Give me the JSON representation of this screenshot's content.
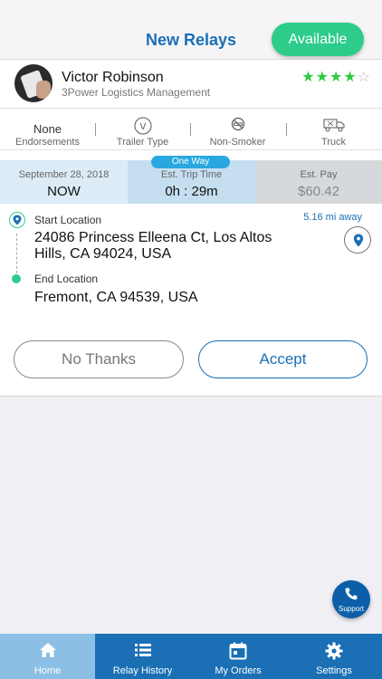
{
  "header": {
    "title": "New Relays",
    "status_button": "Available"
  },
  "driver": {
    "name": "Victor Robinson",
    "company": "3Power Logistics Management",
    "rating": 4,
    "rating_max": 5
  },
  "attributes": [
    {
      "value": "None",
      "label": "Endorsements",
      "icon": ""
    },
    {
      "value": "",
      "label": "Trailer Type",
      "icon": "v-circle-icon"
    },
    {
      "value": "",
      "label": "Non-Smoker",
      "icon": "no-smoking-icon"
    },
    {
      "value": "",
      "label": "Truck",
      "icon": "truck-icon"
    }
  ],
  "trip": {
    "tag": "One Way",
    "date_label": "September 28, 2018",
    "date_value": "NOW",
    "time_label": "Est. Trip Time",
    "time_value": "0h : 29m",
    "pay_label": "Est. Pay",
    "pay_value": "$60.42"
  },
  "route": {
    "distance": "5.16 mi away",
    "start_label": "Start Location",
    "start_address": "24086 Princess Elleena Ct, Los Altos Hills, CA 94024, USA",
    "end_label": "End Location",
    "end_address": "Fremont, CA 94539, USA"
  },
  "actions": {
    "decline": "No Thanks",
    "accept": "Accept"
  },
  "support": {
    "label": "Support"
  },
  "tabs": [
    {
      "label": "Home",
      "icon": "home-icon",
      "active": true
    },
    {
      "label": "Relay History",
      "icon": "list-icon",
      "active": false
    },
    {
      "label": "My Orders",
      "icon": "calendar-icon",
      "active": false
    },
    {
      "label": "Settings",
      "icon": "gear-icon",
      "active": false
    }
  ],
  "colors": {
    "brand": "#1a6fb5",
    "available": "#2ecc8a",
    "star": "#2ecc40",
    "tag": "#29a8e0"
  }
}
